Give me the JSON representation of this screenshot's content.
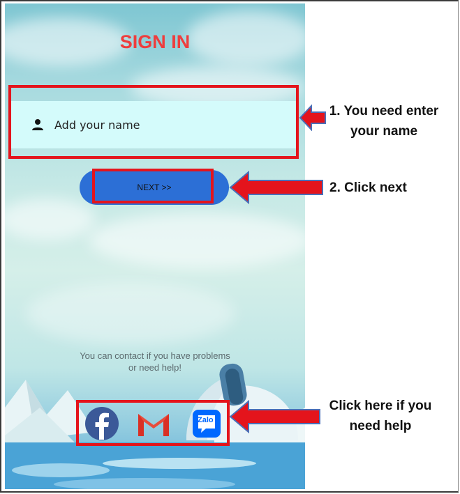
{
  "screen": {
    "title": "SIGN IN",
    "name_field": {
      "placeholder": "Add your name",
      "value": ""
    },
    "next_button": {
      "label": "NEXT >>"
    },
    "contact_text": "You can contact if you have problems or need help!",
    "social_links": [
      {
        "name": "Facebook",
        "icon": "facebook-icon"
      },
      {
        "name": "Gmail",
        "icon": "gmail-icon"
      },
      {
        "name": "Zalo",
        "icon": "zalo-icon",
        "text": "Zalo"
      }
    ]
  },
  "annotations": {
    "step1": "1. You need enter your name",
    "step2": "2. Click next",
    "help": "Click here if you need help"
  },
  "colors": {
    "title_red": "#ee3d3d",
    "button_blue": "#2c6fd6",
    "field_bg": "#d4fbfb",
    "highlight_red": "#e4141c",
    "arrow_blue": "#4a6fb8"
  }
}
